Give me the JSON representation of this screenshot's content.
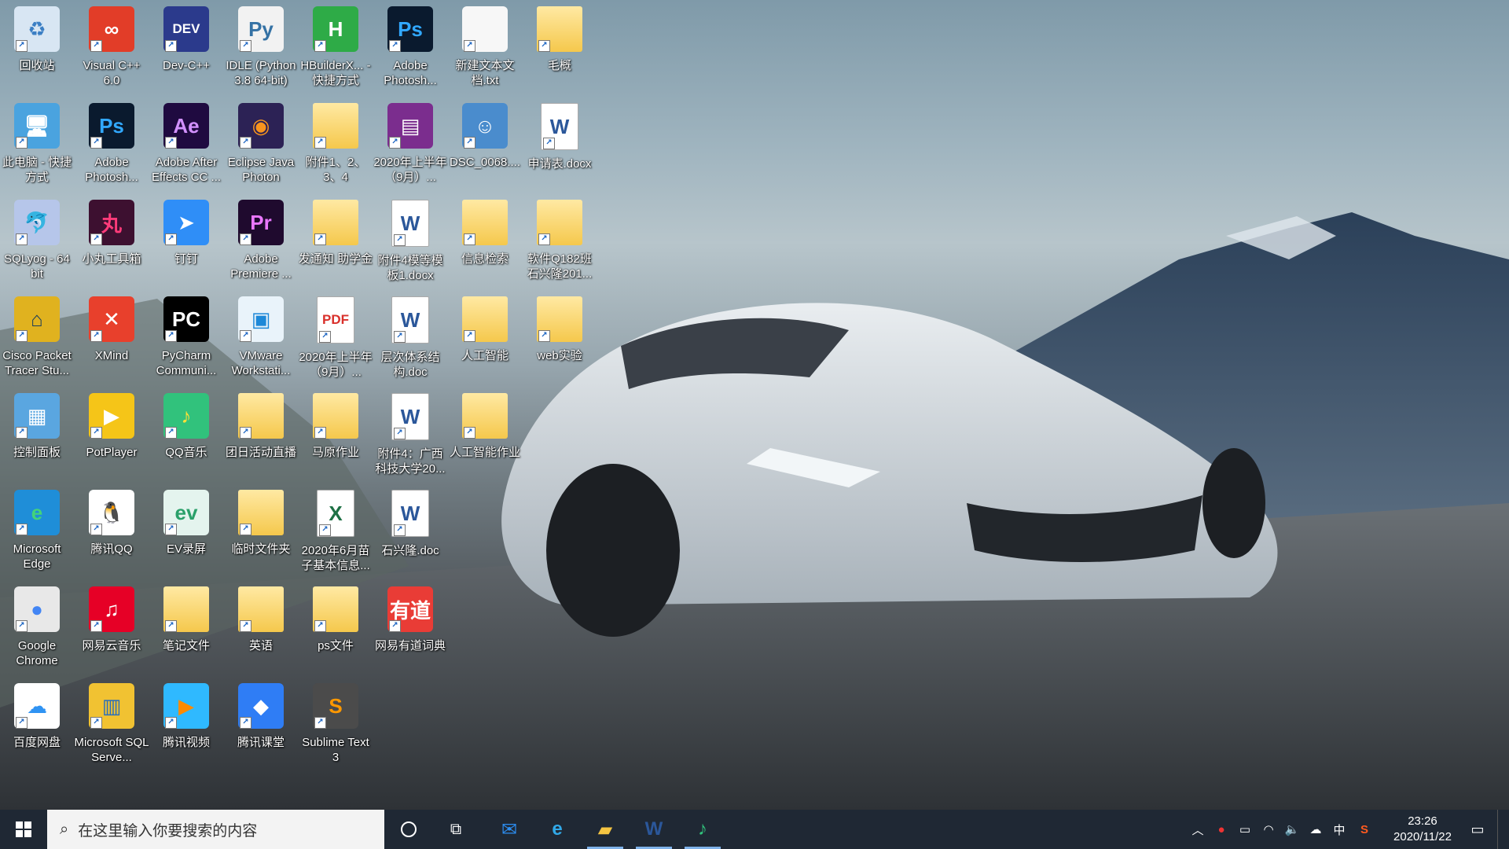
{
  "desktop": {
    "icons": [
      {
        "label": "回收站",
        "icon": "recycle-bin-icon",
        "glyph": "♻",
        "bg": "#d8e6f3",
        "fg": "#3b7fc4"
      },
      {
        "label": "Visual C++ 6.0",
        "icon": "visual-cpp-icon",
        "glyph": "∞",
        "bg": "#e23d28",
        "fg": "#ffffff"
      },
      {
        "label": "Dev-C++",
        "icon": "devcpp-icon",
        "glyph": "DEV",
        "bg": "#2b3a8c",
        "fg": "#ffffff"
      },
      {
        "label": "IDLE (Python 3.8 64-bit)",
        "icon": "python-idle-icon",
        "glyph": "Py",
        "bg": "#f2f2f2",
        "fg": "#3572a5"
      },
      {
        "label": "HBuilderX... - 快捷方式",
        "icon": "hbuilderx-icon",
        "glyph": "H",
        "bg": "#2eab47",
        "fg": "#ffffff"
      },
      {
        "label": "Adobe Photosh...",
        "icon": "photoshop-icon",
        "glyph": "Ps",
        "bg": "#0a1a2e",
        "fg": "#31a8ff"
      },
      {
        "label": "新建文本文档.txt",
        "icon": "text-file-icon",
        "glyph": "",
        "bg": "#f7f7f7",
        "fg": "#888888"
      },
      {
        "label": "毛概",
        "icon": "folder-icon",
        "glyph": "",
        "bg": "folder",
        "fg": "#ffffff"
      },
      {
        "label": "此电脑 - 快捷方式",
        "icon": "this-pc-icon",
        "glyph": "🖥",
        "bg": "#4aa3df",
        "fg": "#ffffff"
      },
      {
        "label": "Adobe Photosh...",
        "icon": "photoshop-icon",
        "glyph": "Ps",
        "bg": "#0a1a2e",
        "fg": "#31a8ff"
      },
      {
        "label": "Adobe After Effects CC ...",
        "icon": "after-effects-icon",
        "glyph": "Ae",
        "bg": "#1f0a40",
        "fg": "#d291ff"
      },
      {
        "label": "Eclipse Java Photon",
        "icon": "eclipse-icon",
        "glyph": "◉",
        "bg": "#2c2255",
        "fg": "#f7941e"
      },
      {
        "label": "附件1、2、3、4",
        "icon": "folder-icon",
        "glyph": "",
        "bg": "folder",
        "fg": "#ffffff"
      },
      {
        "label": "2020年上半年（9月）...",
        "icon": "winrar-icon",
        "glyph": "▤",
        "bg": "#7b2d8e",
        "fg": "#ffffff"
      },
      {
        "label": "DSC_0068....",
        "icon": "photo-icon",
        "glyph": "☺",
        "bg": "#4a8ccd",
        "fg": "#ffffff"
      },
      {
        "label": "申请表.docx",
        "icon": "word-doc-icon",
        "glyph": "W",
        "bg": "doc",
        "fg": "#2b579a"
      },
      {
        "label": "SQLyog - 64 bit",
        "icon": "sqlyog-icon",
        "glyph": "🐬",
        "bg": "#b6c6ea",
        "fg": "#4056a8"
      },
      {
        "label": "小丸工具箱",
        "icon": "xiaowan-toolbox-icon",
        "glyph": "丸",
        "bg": "#3d1030",
        "fg": "#ff3b7a"
      },
      {
        "label": "钉钉",
        "icon": "dingtalk-icon",
        "glyph": "➤",
        "bg": "#2f8ef7",
        "fg": "#ffffff"
      },
      {
        "label": "Adobe Premiere ...",
        "icon": "premiere-icon",
        "glyph": "Pr",
        "bg": "#1f0a2e",
        "fg": "#ea77ff"
      },
      {
        "label": "发通知 助学金",
        "icon": "folder-icon",
        "glyph": "",
        "bg": "folder",
        "fg": "#ffffff"
      },
      {
        "label": "附件4模等模板1.docx",
        "icon": "word-doc-icon",
        "glyph": "W",
        "bg": "doc",
        "fg": "#2b579a"
      },
      {
        "label": "信息检索",
        "icon": "folder-icon",
        "glyph": "",
        "bg": "folder",
        "fg": "#ffffff"
      },
      {
        "label": "软件Q182班石兴隆201...",
        "icon": "folder-icon",
        "glyph": "",
        "bg": "folder",
        "fg": "#ffffff"
      },
      {
        "label": "Cisco Packet Tracer Stu...",
        "icon": "cisco-packet-tracer-icon",
        "glyph": "⌂",
        "bg": "#e0b21f",
        "fg": "#1a3d5c"
      },
      {
        "label": "XMind",
        "icon": "xmind-icon",
        "glyph": "✕",
        "bg": "#e8402c",
        "fg": "#ffffff"
      },
      {
        "label": "PyCharm Communi...",
        "icon": "pycharm-icon",
        "glyph": "PC",
        "bg": "#000000",
        "fg": "#ffffff"
      },
      {
        "label": "VMware Workstati...",
        "icon": "vmware-icon",
        "glyph": "▣",
        "bg": "#e9f3fa",
        "fg": "#1d88d8"
      },
      {
        "label": "2020年上半年（9月）...",
        "icon": "pdf-icon",
        "glyph": "PDF",
        "bg": "doc",
        "fg": "#d9302b"
      },
      {
        "label": "层次体系结构.doc",
        "icon": "word-doc-icon",
        "glyph": "W",
        "bg": "doc",
        "fg": "#2b579a"
      },
      {
        "label": "人工智能",
        "icon": "folder-icon",
        "glyph": "",
        "bg": "folder",
        "fg": "#ffffff"
      },
      {
        "label": "web实验",
        "icon": "folder-icon",
        "glyph": "",
        "bg": "folder",
        "fg": "#ffffff"
      },
      {
        "label": "控制面板",
        "icon": "control-panel-icon",
        "glyph": "▦",
        "bg": "#5aa6e0",
        "fg": "#ffffff"
      },
      {
        "label": "PotPlayer",
        "icon": "potplayer-icon",
        "glyph": "▶",
        "bg": "#f5c518",
        "fg": "#ffffff"
      },
      {
        "label": "QQ音乐",
        "icon": "qq-music-icon",
        "glyph": "♪",
        "bg": "#31c27c",
        "fg": "#ffe036"
      },
      {
        "label": "团日活动直播",
        "icon": "folder-icon",
        "glyph": "",
        "bg": "folder",
        "fg": "#ffffff"
      },
      {
        "label": "马原作业",
        "icon": "folder-icon",
        "glyph": "",
        "bg": "folder",
        "fg": "#ffffff"
      },
      {
        "label": "附件4：广西科技大学20...",
        "icon": "word-doc-icon",
        "glyph": "W",
        "bg": "doc",
        "fg": "#2b579a"
      },
      {
        "label": "人工智能作业",
        "icon": "folder-icon",
        "glyph": "",
        "bg": "folder",
        "fg": "#ffffff"
      },
      {
        "label": "Microsoft Edge",
        "icon": "edge-icon",
        "glyph": "e",
        "bg": "#1f8ed8",
        "fg": "#43d37a"
      },
      {
        "label": "腾讯QQ",
        "icon": "qq-icon",
        "glyph": "🐧",
        "bg": "#ffffff",
        "fg": "#000000"
      },
      {
        "label": "EV录屏",
        "icon": "ev-recorder-icon",
        "glyph": "ev",
        "bg": "#e4f4ee",
        "fg": "#2aa06a"
      },
      {
        "label": "临时文件夹",
        "icon": "folder-icon",
        "glyph": "",
        "bg": "folder",
        "fg": "#ffffff"
      },
      {
        "label": "2020年6月苗子基本信息...",
        "icon": "excel-icon",
        "glyph": "X",
        "bg": "doc",
        "fg": "#1d7044"
      },
      {
        "label": "石兴隆.doc",
        "icon": "word-doc-icon",
        "glyph": "W",
        "bg": "doc",
        "fg": "#2b579a"
      },
      {
        "label": "Google Chrome",
        "icon": "chrome-icon",
        "glyph": "●",
        "bg": "#e8e8e8",
        "fg": "#4285f4"
      },
      {
        "label": "网易云音乐",
        "icon": "netease-music-icon",
        "glyph": "♫",
        "bg": "#e60026",
        "fg": "#ffffff"
      },
      {
        "label": "笔记文件",
        "icon": "folder-icon",
        "glyph": "",
        "bg": "folder",
        "fg": "#ffffff"
      },
      {
        "label": "英语",
        "icon": "folder-icon",
        "glyph": "",
        "bg": "folder",
        "fg": "#ffffff"
      },
      {
        "label": "ps文件",
        "icon": "folder-icon",
        "glyph": "",
        "bg": "folder",
        "fg": "#ffffff"
      },
      {
        "label": "网易有道词典",
        "icon": "youdao-icon",
        "glyph": "有道",
        "bg": "#e93c36",
        "fg": "#ffffff"
      },
      {
        "label": "百度网盘",
        "icon": "baidu-netdisk-icon",
        "glyph": "☁",
        "bg": "#ffffff",
        "fg": "#2f93f3"
      },
      {
        "label": "Microsoft SQL Serve...",
        "icon": "sql-server-icon",
        "glyph": "▥",
        "bg": "#f1c232",
        "fg": "#2a6ebb"
      },
      {
        "label": "腾讯视频",
        "icon": "tencent-video-icon",
        "glyph": "▶",
        "bg": "#2fb9ff",
        "fg": "#ff8a00"
      },
      {
        "label": "腾讯课堂",
        "icon": "tencent-classroom-icon",
        "glyph": "◆",
        "bg": "#2f7df5",
        "fg": "#ffffff"
      },
      {
        "label": "Sublime Text 3",
        "icon": "sublime-text-icon",
        "glyph": "S",
        "bg": "#4b4b4b",
        "fg": "#ff9800"
      }
    ]
  },
  "taskbar": {
    "search_placeholder": "在这里输入你要搜索的内容",
    "apps": [
      {
        "name": "mail-icon",
        "glyph": "✉",
        "color": "#2c8ef2",
        "active": false
      },
      {
        "name": "edge-icon",
        "glyph": "e",
        "color": "#31a9e8",
        "active": false
      },
      {
        "name": "file-explorer-icon",
        "glyph": "▰",
        "color": "#f5c542",
        "active": true
      },
      {
        "name": "word-icon",
        "glyph": "W",
        "color": "#2b579a",
        "active": true
      },
      {
        "name": "qq-music-icon",
        "glyph": "♪",
        "color": "#31c27c",
        "active": true
      }
    ],
    "tray": {
      "ime": "中",
      "time": "23:26",
      "date": "2020/11/22"
    }
  }
}
